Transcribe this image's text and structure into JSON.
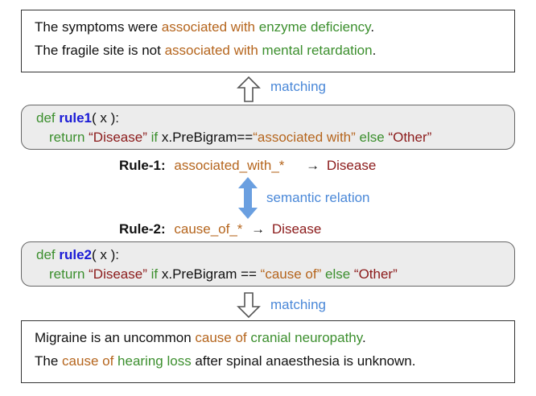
{
  "top_box": {
    "line1": {
      "a": "The symptoms were ",
      "b": "associated with",
      "c": " ",
      "d": "enzyme deficiency",
      "e": "."
    },
    "line2": {
      "a": "The fragile site is not ",
      "b": "associated with",
      "c": " ",
      "d": "mental retardation",
      "e": "."
    }
  },
  "arrow_up_label": "matching",
  "rule1_box": {
    "def_kw": "def ",
    "name": "rule1",
    "sig": "( x ):",
    "ret_kw": "return ",
    "q1": "“Disease”",
    "if_kw": " if ",
    "cond": "x.PreBigram==",
    "str": "“associated with”",
    "else_kw": " else ",
    "q2": "“Other”"
  },
  "rule1_label": {
    "prefix": "Rule-1:",
    "pattern": "associated_with_*",
    "arrow": "→",
    "target": "Disease"
  },
  "relation_label": "semantic relation",
  "rule2_label": {
    "prefix": "Rule-2:",
    "pattern": "cause_of_*",
    "arrow": "→",
    "target": "Disease"
  },
  "rule2_box": {
    "def_kw": "def ",
    "name": "rule2",
    "sig": "( x ):",
    "ret_kw": "return ",
    "q1": "“Disease”",
    "if_kw": " if ",
    "cond": "x.PreBigram == ",
    "str": "“cause of”",
    "else_kw": " else ",
    "q2": "“Other”"
  },
  "arrow_down_label": "matching",
  "bottom_box": {
    "line1": {
      "a": "Migraine is an uncommon ",
      "b": "cause of",
      "c": " ",
      "d": "cranial neuropathy",
      "e": "."
    },
    "line2": {
      "a": "The ",
      "b": "cause of",
      "c": " ",
      "d": "hearing loss",
      "e": " after spinal anaesthesia is unknown."
    }
  },
  "colors": {
    "pattern": "#b5651d",
    "argument": "#3c8f2e",
    "label": "#8b1a1a",
    "function_name": "#1a1ad6",
    "annotation": "#4a88d8"
  }
}
